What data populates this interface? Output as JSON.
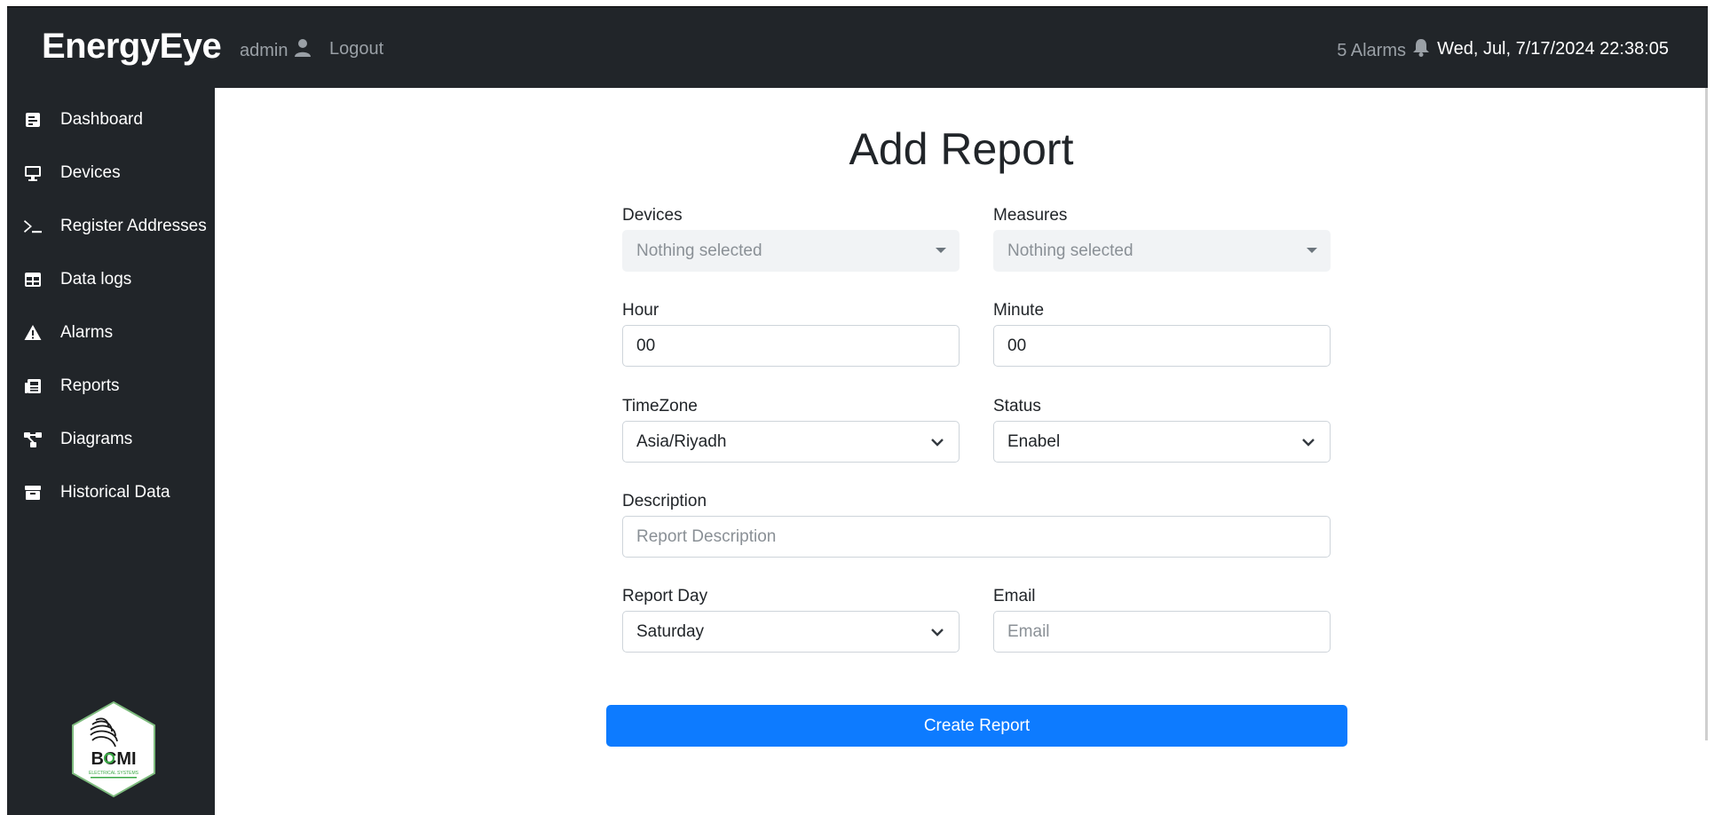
{
  "header": {
    "brand": "EnergyEye",
    "user": "admin",
    "logout": "Logout",
    "alarms": "5 Alarms",
    "datetime": "Wed, Jul, 7/17/2024 22:38:05"
  },
  "sidebar": {
    "items": [
      {
        "label": "Dashboard",
        "icon": "dashboard-icon"
      },
      {
        "label": "Devices",
        "icon": "monitor-icon"
      },
      {
        "label": "Register Addresses",
        "icon": "terminal-icon"
      },
      {
        "label": "Data logs",
        "icon": "table-icon"
      },
      {
        "label": "Alarms",
        "icon": "warning-icon"
      },
      {
        "label": "Reports",
        "icon": "newspaper-icon"
      },
      {
        "label": "Diagrams",
        "icon": "diagram-icon"
      },
      {
        "label": "Historical Data",
        "icon": "archive-icon"
      }
    ],
    "logo_text": "BCMI",
    "logo_subtext": "ELECTRICAL SYSTEMS"
  },
  "form": {
    "title": "Add Report",
    "devices": {
      "label": "Devices",
      "value": "Nothing selected"
    },
    "measures": {
      "label": "Measures",
      "value": "Nothing selected"
    },
    "hour": {
      "label": "Hour",
      "value": "00"
    },
    "minute": {
      "label": "Minute",
      "value": "00"
    },
    "timezone": {
      "label": "TimeZone",
      "value": "Asia/Riyadh"
    },
    "status": {
      "label": "Status",
      "value": "Enabel"
    },
    "description": {
      "label": "Description",
      "placeholder": "Report Description"
    },
    "report_day": {
      "label": "Report Day",
      "value": "Saturday"
    },
    "email": {
      "label": "Email",
      "placeholder": "Email"
    },
    "submit": "Create Report"
  },
  "colors": {
    "dark": "#212529",
    "primary": "#0d7bff"
  }
}
